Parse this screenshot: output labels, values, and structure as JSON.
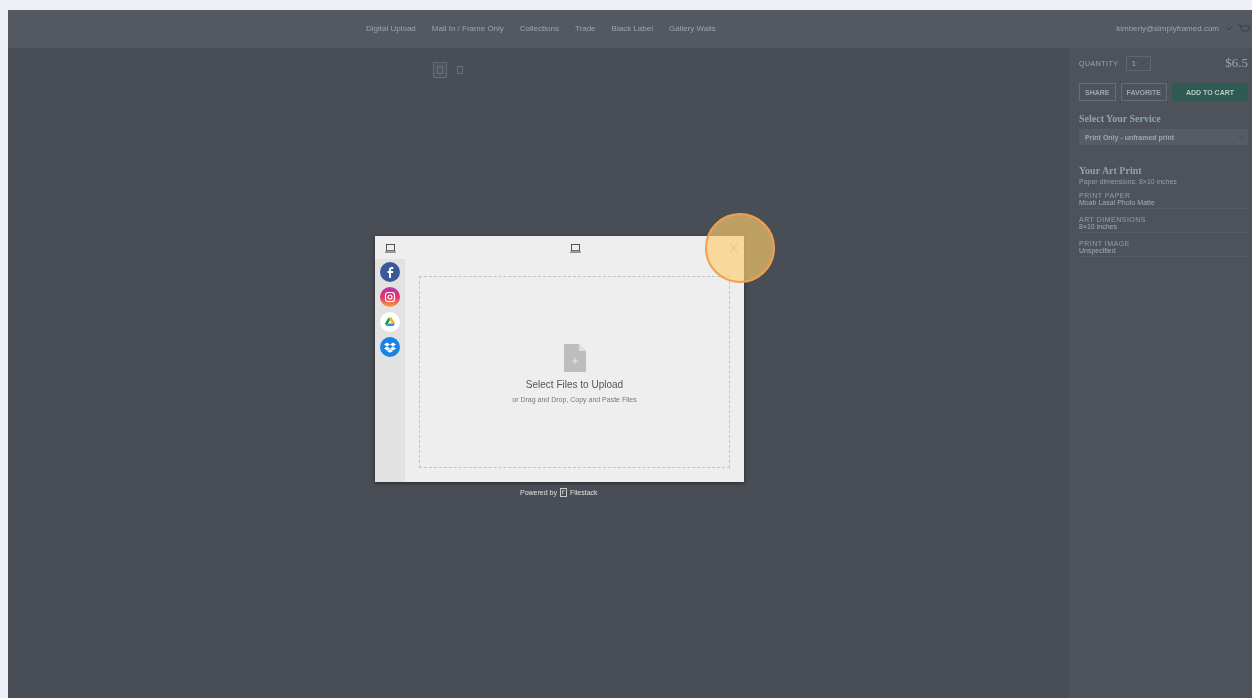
{
  "nav": {
    "links": [
      "Digital Upload",
      "Mail In / Frame Only",
      "Collections",
      "Trade",
      "Black Label",
      "Gallery Walls"
    ],
    "account": "kimberly@simplyframed.com"
  },
  "thumbnails": [
    {
      "selected": true
    },
    {
      "selected": false
    }
  ],
  "product": {
    "quantity_label": "QUANTITY",
    "quantity": "1",
    "price": "$6.5",
    "buttons": [
      {
        "label": "SHARE",
        "kind": "outline"
      },
      {
        "label": "FAVORITE",
        "kind": "outline"
      },
      {
        "label": "ADD TO CART",
        "kind": "primary"
      }
    ],
    "service_title": "Select Your Service",
    "service": "Print Only - unframed print",
    "print_title": "Your Art Print",
    "print_subtitle": "Paper dimensions: 8×10 inches",
    "details": [
      {
        "label": "PRINT PAPER",
        "value": "Moab Lasal Photo Matte"
      },
      {
        "label": "ART DIMENSIONS",
        "value": "8×10 inches"
      },
      {
        "label": "PRINT IMAGE",
        "value": "Unspecified"
      }
    ]
  },
  "uploader": {
    "sources": [
      {
        "kind": "facebook"
      },
      {
        "kind": "instagram"
      },
      {
        "kind": "drive"
      },
      {
        "kind": "dropbox"
      }
    ],
    "drop_title": "Select Files to Upload",
    "drop_hint": "or Drag and Drop, Copy and Paste Files",
    "powered_by": "Powered by",
    "brand": "Filestack"
  }
}
